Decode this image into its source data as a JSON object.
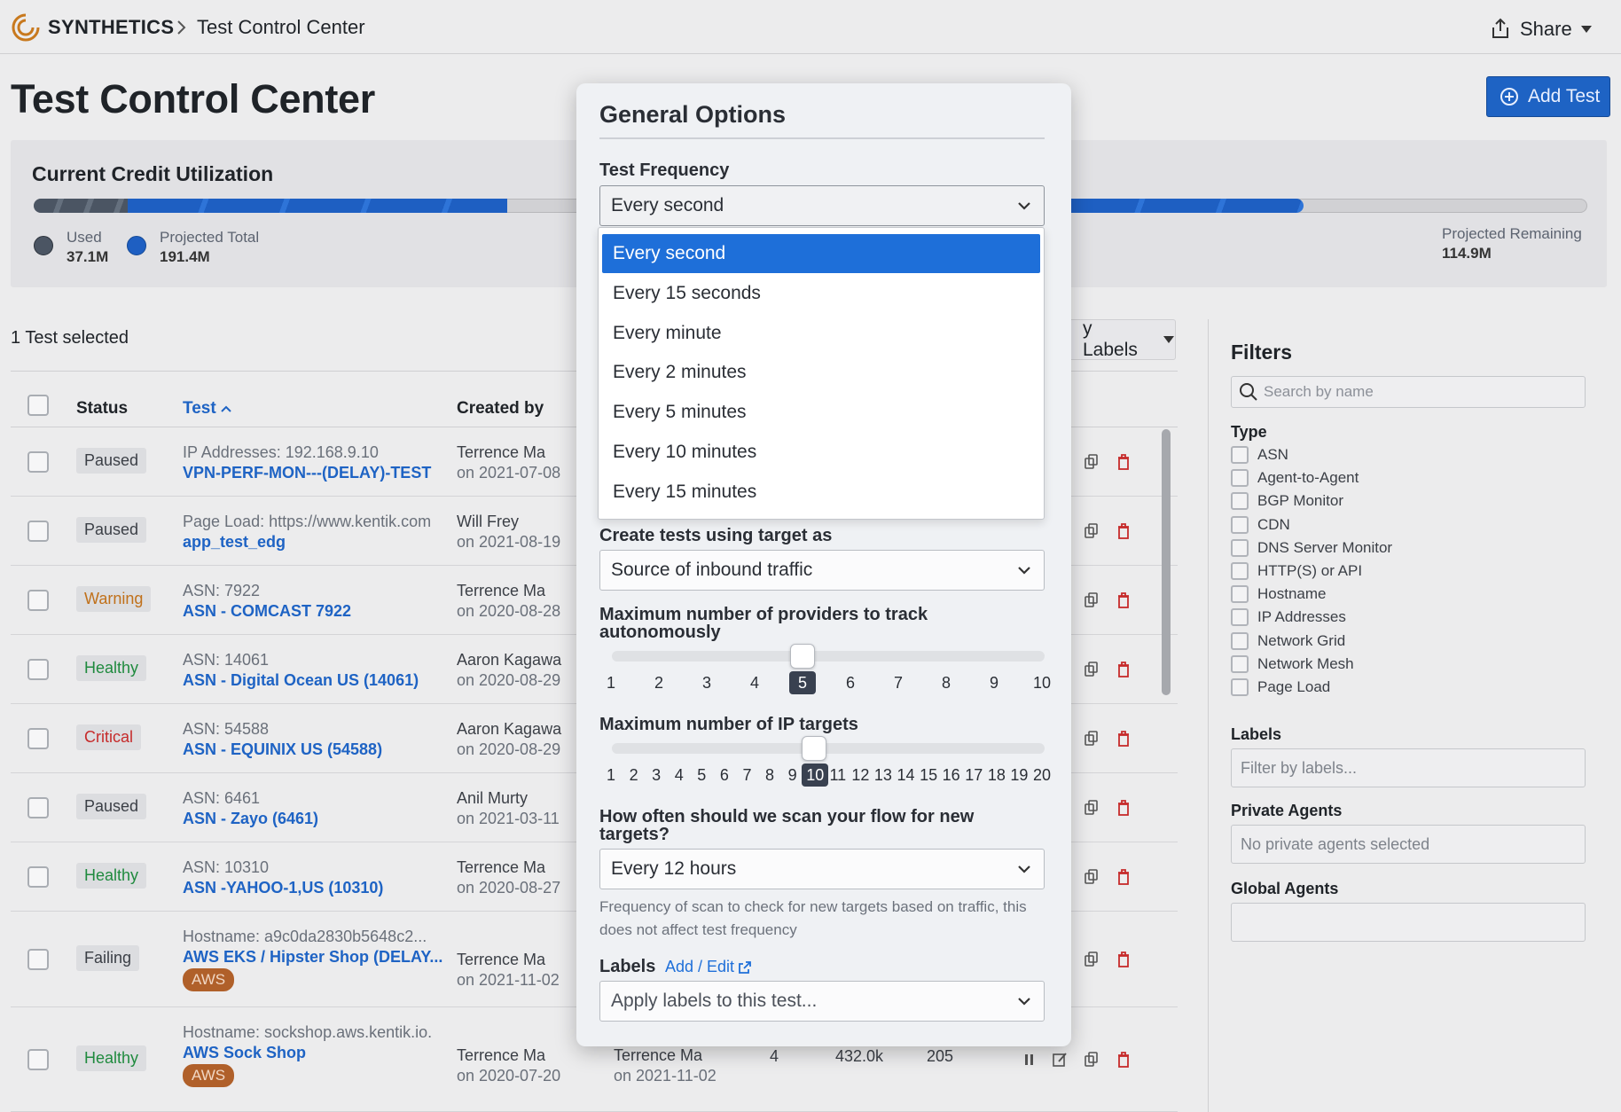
{
  "header": {
    "brand": "SYNTHETICS",
    "breadcrumb": "Test Control Center",
    "share_label": "Share"
  },
  "page": {
    "title": "Test Control Center",
    "add_test_label": "Add Test"
  },
  "credit": {
    "title": "Current Credit Utilization",
    "used_label": "Used",
    "used_value": "37.1M",
    "projected_label": "Projected Total",
    "projected_value": "191.4M",
    "remaining_label": "Projected Remaining",
    "remaining_value": "114.9M"
  },
  "table": {
    "selection_text": "1 Test selected",
    "labels_button": "y Labels",
    "columns": {
      "status": "Status",
      "test": "Test",
      "created_by": "Created by"
    },
    "rows": [
      {
        "status": "Paused",
        "sub": "IP Addresses: 192.168.9.10",
        "name": "VPN-PERF-MON---(DELAY)-TEST",
        "creator": "Terrence Ma",
        "date": "on 2021-07-08"
      },
      {
        "status": "Paused",
        "sub": "Page Load: https://www.kentik.com",
        "name": "app_test_edg",
        "creator": "Will Frey",
        "date": "on 2021-08-19"
      },
      {
        "status": "Warning",
        "sub": "ASN: 7922",
        "name": "ASN - COMCAST 7922",
        "creator": "Terrence Ma",
        "date": "on 2020-08-28"
      },
      {
        "status": "Healthy",
        "sub": "ASN: 14061",
        "name": "ASN - Digital Ocean US (14061)",
        "creator": "Aaron Kagawa",
        "date": "on 2020-08-29"
      },
      {
        "status": "Critical",
        "sub": "ASN: 54588",
        "name": "ASN - EQUINIX US (54588)",
        "creator": "Aaron Kagawa",
        "date": "on 2020-08-29"
      },
      {
        "status": "Paused",
        "sub": "ASN: 6461",
        "name": "ASN - Zayo (6461)",
        "creator": "Anil Murty",
        "date": "on 2021-03-11"
      },
      {
        "status": "Healthy",
        "sub": "ASN: 10310",
        "name": "ASN -YAHOO-1,US (10310)",
        "creator": "Terrence Ma",
        "date": "on 2020-08-27"
      },
      {
        "status": "Failing",
        "sub": "Hostname: a9c0da2830b5648c2...",
        "name": "AWS EKS / Hipster Shop (DELAY...",
        "creator": "Terrence Ma",
        "date": "on 2021-11-02",
        "tag": "AWS"
      },
      {
        "status": "Healthy",
        "sub": "Hostname: sockshop.aws.kentik.io.",
        "name": "AWS Sock Shop",
        "creator": "Terrence Ma",
        "date": "on 2020-07-20",
        "tag": "AWS",
        "modified_by": "Terrence Ma",
        "modified_date": "on 2021-11-02",
        "agents": "4",
        "credits": "432.0k",
        "extra": "205"
      }
    ]
  },
  "filters": {
    "title": "Filters",
    "search_placeholder": "Search by name",
    "type_heading": "Type",
    "types": [
      "ASN",
      "Agent-to-Agent",
      "BGP Monitor",
      "CDN",
      "DNS Server Monitor",
      "HTTP(S) or API",
      "Hostname",
      "IP Addresses",
      "Network Grid",
      "Network Mesh",
      "Page Load"
    ],
    "labels_heading": "Labels",
    "labels_placeholder": "Filter by labels...",
    "private_heading": "Private Agents",
    "private_value": "No private agents selected",
    "global_heading": "Global Agents"
  },
  "modal": {
    "title": "General Options",
    "frequency_label": "Test Frequency",
    "frequency_value": "Every second",
    "frequency_options": [
      "Every second",
      "Every 15 seconds",
      "Every minute",
      "Every 2 minutes",
      "Every 5 minutes",
      "Every 10 minutes",
      "Every 15 minutes"
    ],
    "target_label": "Create tests using target as",
    "target_value": "Source of inbound traffic",
    "providers_label": "Maximum number of providers to track autonomously",
    "providers_ticks": [
      "1",
      "2",
      "3",
      "4",
      "5",
      "6",
      "7",
      "8",
      "9",
      "10"
    ],
    "providers_value": 5,
    "ip_label": "Maximum number of IP targets",
    "ip_ticks": [
      "1",
      "2",
      "3",
      "4",
      "5",
      "6",
      "7",
      "8",
      "9",
      "10",
      "11",
      "12",
      "13",
      "14",
      "15",
      "16",
      "17",
      "18",
      "19",
      "20"
    ],
    "ip_value": 10,
    "scan_label": "How often should we scan your flow for new targets?",
    "scan_value": "Every 12 hours",
    "scan_help": "Frequency of scan to check for new targets based on traffic, this does not affect test frequency",
    "labels_label": "Labels",
    "labels_link": "Add / Edit",
    "labels_placeholder": "Apply labels to this test..."
  },
  "colors": {
    "accent": "#1e63c4",
    "warning": "#c0701a",
    "healthy": "#1f8a3e",
    "critical": "#c62b2b",
    "aws_tag": "#b0602a"
  }
}
